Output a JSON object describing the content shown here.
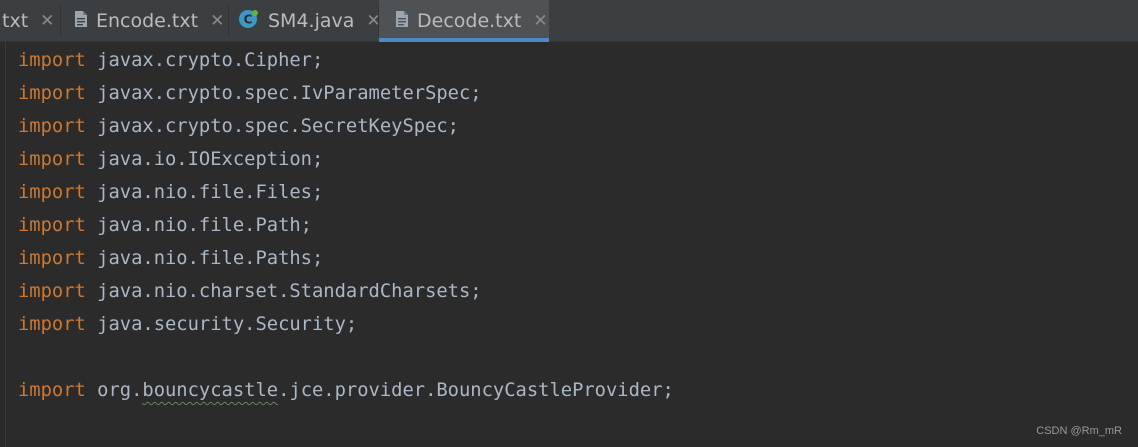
{
  "tabs": [
    {
      "label": "txt",
      "icon": "",
      "active": false
    },
    {
      "label": "Encode.txt",
      "icon": "text-file-icon",
      "active": false
    },
    {
      "label": "SM4.java",
      "icon": "java-class-icon",
      "active": false
    },
    {
      "label": "Decode.txt",
      "icon": "text-file-icon",
      "active": true
    }
  ],
  "close_glyph": "✕",
  "code": {
    "keyword": "import",
    "lines": [
      "javax.crypto.Cipher;",
      "javax.crypto.spec.IvParameterSpec;",
      "javax.crypto.spec.SecretKeySpec;",
      "java.io.IOException;",
      "java.nio.file.Files;",
      "java.nio.file.Path;",
      "java.nio.file.Paths;",
      "java.nio.charset.StandardCharsets;",
      "java.security.Security;"
    ],
    "last_line": {
      "prefix": "org.",
      "flagged": "bouncycastle",
      "suffix": ".jce.provider.BouncyCastleProvider;"
    }
  },
  "watermark": "CSDN @Rm_mR",
  "colors": {
    "keyword": "#cc7832",
    "text": "#a9b7c6",
    "tab_underline": "#4a88c7",
    "editor_bg": "#2b2b2b"
  }
}
